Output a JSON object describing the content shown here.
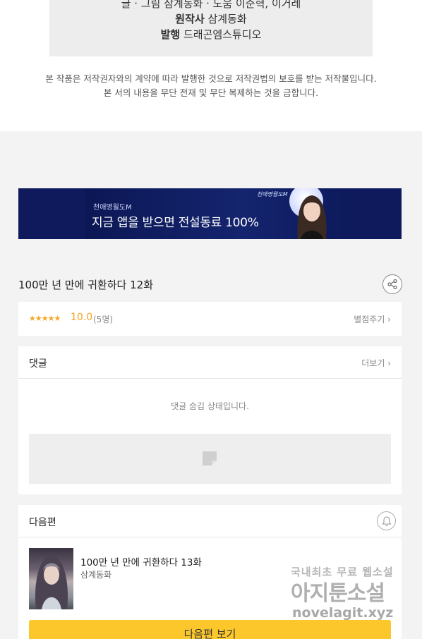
{
  "credits": {
    "line1": "글 · 그림 삼계동화 · 도움 이준혁, 이거레",
    "original_label": "원작사",
    "original_value": "삼계동화",
    "publisher_label": "발행",
    "publisher_value": "드래곤엠스튜디오"
  },
  "notice": {
    "line1": "본 작품은 저작권자와의 계약에 따라 발행한 것으로 저작권법의 보호를 받는 저작물입니다.",
    "line2": "본 서의 내용을 무단 전재 및 무단 복제하는 것을 금합니다."
  },
  "banner": {
    "small_text": "천애명월도M",
    "big_text": "지금 앱을 받으면 전설동료 100%",
    "logo_text": "천애명월도M"
  },
  "episode": {
    "title": "100만 년 만에 귀환하다 12화"
  },
  "rating": {
    "stars": "★★★★★",
    "score": "10.0",
    "votes": "(5명)",
    "rate_link": "별점주기 ›"
  },
  "comments": {
    "title": "댓글",
    "more": "더보기 ›",
    "hidden_message": "댓글 숨김 상태입니다."
  },
  "next": {
    "header": "다음편",
    "title": "100만 년 만에 귀환하다 13화",
    "author": "삼계동화",
    "button": "다음편 보기"
  },
  "watermark": {
    "line1": "국내최초 무료 웹소설",
    "line2": "아지툰소설",
    "line3": "novelagit.xyz"
  },
  "colors": {
    "accent": "#fcc72b",
    "star": "#f5a623",
    "banner_bg": "#0e1a5c"
  }
}
